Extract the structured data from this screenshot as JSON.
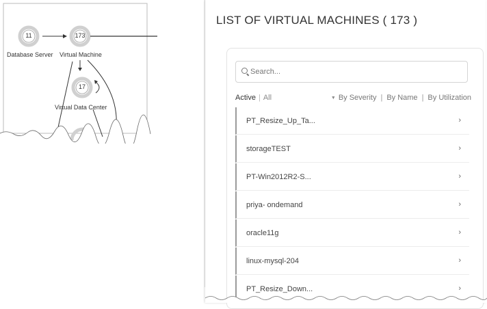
{
  "topology": {
    "nodes": [
      {
        "id": "database-server",
        "label": "Database Server",
        "count": "11"
      },
      {
        "id": "virtual-machine",
        "label": "Virtual Machine",
        "count": "173"
      },
      {
        "id": "virtual-data-center",
        "label": "Virtual Data Center",
        "count": "17"
      }
    ]
  },
  "panel": {
    "title": "LIST OF VIRTUAL MACHINES ( 173 )",
    "search_placeholder": "Search...",
    "filters": {
      "active": "Active",
      "all": "All"
    },
    "sort": {
      "by_severity": "By Severity",
      "by_name": "By Name",
      "by_utilization": "By Utilization"
    },
    "items": [
      {
        "name": "PT_Resize_Up_Ta..."
      },
      {
        "name": "storageTEST"
      },
      {
        "name": "PT-Win2012R2-S..."
      },
      {
        "name": "priya- ondemand"
      },
      {
        "name": "oracle11g"
      },
      {
        "name": "linux-mysql-204"
      },
      {
        "name": "PT_Resize_Down..."
      }
    ],
    "chevron": "›"
  },
  "colors": {
    "ring": "#c9c9c9",
    "ring_inner": "#8a8a8a",
    "border": "#e2e2e2",
    "arrow": "#333333"
  }
}
